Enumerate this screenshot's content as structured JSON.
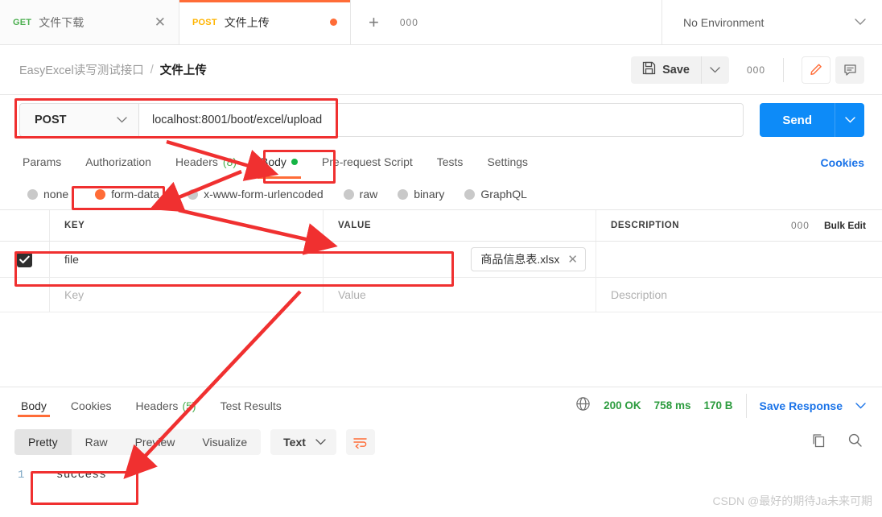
{
  "tabbar": {
    "tabs": [
      {
        "method": "GET",
        "title": "文件下载",
        "state": "inactive",
        "close": "✕"
      },
      {
        "method": "POST",
        "title": "文件上传",
        "state": "active"
      }
    ],
    "new_tab": "+",
    "more": "000",
    "environment": "No Environment"
  },
  "breadcrumb": {
    "collection": "EasyExcel读写测试接口",
    "separator": "/",
    "current": "文件上传",
    "save_label": "Save",
    "more": "000"
  },
  "url": {
    "method": "POST",
    "value": "localhost:8001/boot/excel/upload",
    "send_label": "Send"
  },
  "request_tabs": [
    {
      "label": "Params",
      "active": false
    },
    {
      "label": "Authorization",
      "active": false
    },
    {
      "label": "Headers",
      "count": "(8)",
      "active": false
    },
    {
      "label": "Body",
      "dot": true,
      "active": true
    },
    {
      "label": "Pre-request Script",
      "active": false
    },
    {
      "label": "Tests",
      "active": false
    },
    {
      "label": "Settings",
      "active": false
    }
  ],
  "cookies_link": "Cookies",
  "body_types": [
    {
      "label": "none",
      "selected": false
    },
    {
      "label": "form-data",
      "selected": true
    },
    {
      "label": "x-www-form-urlencoded",
      "selected": false
    },
    {
      "label": "raw",
      "selected": false
    },
    {
      "label": "binary",
      "selected": false
    },
    {
      "label": "GraphQL",
      "selected": false
    }
  ],
  "kv_table": {
    "headers": {
      "key": "KEY",
      "value": "VALUE",
      "description": "DESCRIPTION",
      "more": "000",
      "bulk_edit": "Bulk Edit"
    },
    "rows": [
      {
        "checked": true,
        "key": "file",
        "file_chip": "商品信息表.xlsx",
        "chip_close": "✕",
        "description": ""
      }
    ],
    "placeholder_row": {
      "key": "Key",
      "value": "Value",
      "description": "Description"
    }
  },
  "response": {
    "tabs": [
      {
        "label": "Body",
        "active": true
      },
      {
        "label": "Cookies",
        "active": false
      },
      {
        "label": "Headers",
        "count": "(5)",
        "active": false
      },
      {
        "label": "Test Results",
        "active": false
      }
    ],
    "status": "200 OK",
    "time": "758 ms",
    "size": "170 B",
    "save_response": "Save Response",
    "view_modes": [
      {
        "label": "Pretty",
        "active": true
      },
      {
        "label": "Raw",
        "active": false
      },
      {
        "label": "Preview",
        "active": false
      },
      {
        "label": "Visualize",
        "active": false
      }
    ],
    "format": "Text",
    "body_lines": [
      {
        "no": "1",
        "text": "success"
      }
    ]
  },
  "watermark": "CSDN @最好的期待Ja未来可期",
  "colors": {
    "accent": "#ff6c37",
    "send": "#0d8bf8",
    "annotation": "#f03030",
    "success_green": "#2d9c3f",
    "link": "#1a73e8"
  }
}
